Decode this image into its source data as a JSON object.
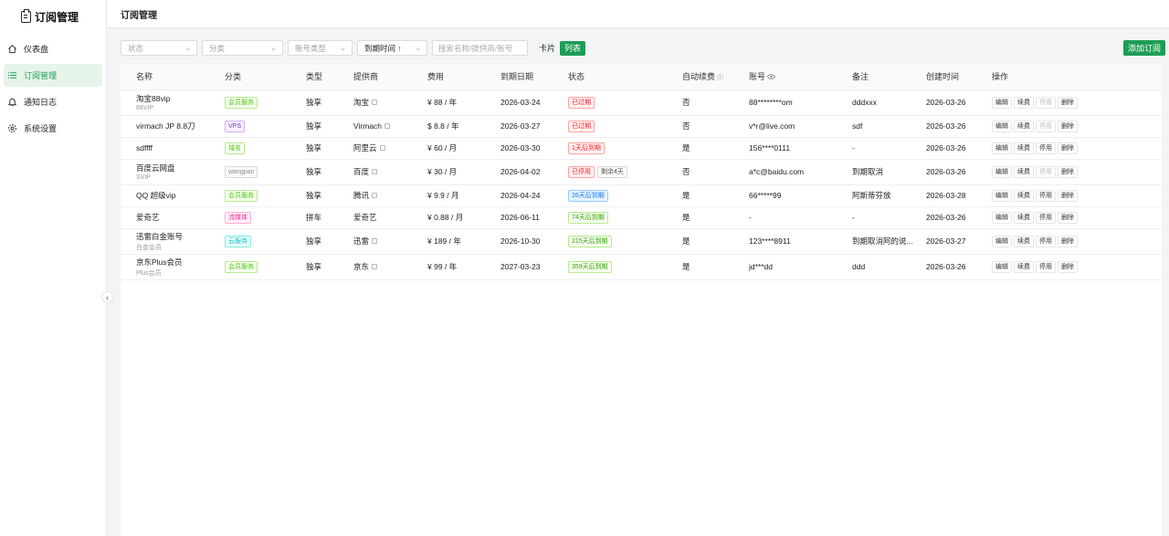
{
  "app": {
    "title": "订阅管理"
  },
  "nav": [
    {
      "label": "仪表盘",
      "icon": "home-icon",
      "active": false
    },
    {
      "label": "订阅管理",
      "icon": "list-icon",
      "active": true
    },
    {
      "label": "通知日志",
      "icon": "bell-icon",
      "active": false
    },
    {
      "label": "系统设置",
      "icon": "gear-icon",
      "active": false
    }
  ],
  "page": {
    "title": "订阅管理"
  },
  "filters": {
    "status_placeholder": "状态",
    "category_placeholder": "分类",
    "account_type_placeholder": "账号类型",
    "sort_value": "到期时间 ↑",
    "search_placeholder": "搜索名称/提供商/账号",
    "view_card": "卡片",
    "view_list": "列表"
  },
  "actions": {
    "add_label": "添加订阅"
  },
  "table": {
    "columns": [
      "名称",
      "分类",
      "类型",
      "提供商",
      "费用",
      "到期日期",
      "状态",
      "自动续费",
      "账号",
      "备注",
      "创建时间",
      "操作"
    ],
    "row_actions": [
      "编辑",
      "续费",
      "停用",
      "删除"
    ],
    "rows": [
      {
        "name": "淘宝88vip",
        "sub": "88VIP",
        "category": "会员服务",
        "category_style": "green",
        "type": "独享",
        "provider": "淘宝",
        "provider_link": true,
        "cost": "¥ 88 / 年",
        "expiry": "2026-03-24",
        "status": "已过期",
        "status_style": "red",
        "status2": "",
        "auto_renew": "否",
        "account": "88********om",
        "note": "dddxxx",
        "created": "2026-03-26",
        "disable_enabled": false
      },
      {
        "name": "virmach JP 8.8刀",
        "sub": "",
        "category": "VPS",
        "category_style": "purple",
        "type": "独享",
        "provider": "Virmach",
        "provider_link": true,
        "cost": "$ 8.8 / 年",
        "expiry": "2026-03-27",
        "status": "已过期",
        "status_style": "red",
        "status2": "",
        "auto_renew": "否",
        "account": "v*r@live.com",
        "note": "sdf",
        "created": "2026-03-26",
        "disable_enabled": false
      },
      {
        "name": "sdffff",
        "sub": "",
        "category": "域名",
        "category_style": "green",
        "type": "独享",
        "provider": "阿里云",
        "provider_link": true,
        "cost": "¥ 60 / 月",
        "expiry": "2026-03-30",
        "status": "1天后到期",
        "status_style": "red",
        "status2": "",
        "auto_renew": "是",
        "account": "156****0111",
        "note": "-",
        "created": "2026-03-26",
        "disable_enabled": true
      },
      {
        "name": "百度云网盘",
        "sub": "SVIP",
        "category": "wangpan",
        "category_style": "gray",
        "type": "独享",
        "provider": "百度",
        "provider_link": true,
        "cost": "¥ 30 / 月",
        "expiry": "2026-04-02",
        "status": "已停用",
        "status_style": "red",
        "status2": "剩余4天",
        "auto_renew": "否",
        "account": "a*c@baidu.com",
        "note": "到期取消",
        "created": "2026-03-26",
        "disable_enabled": false
      },
      {
        "name": "QQ 超级vip",
        "sub": "",
        "category": "会员服务",
        "category_style": "green",
        "type": "独享",
        "provider": "腾讯",
        "provider_link": true,
        "cost": "¥ 9.9 / 月",
        "expiry": "2026-04-24",
        "status": "26天后到期",
        "status_style": "blue",
        "status2": "",
        "auto_renew": "是",
        "account": "66*****99",
        "note": "阿斯蒂芬放",
        "created": "2026-03-28",
        "disable_enabled": true
      },
      {
        "name": "爱奇艺",
        "sub": "",
        "category": "流媒体",
        "category_style": "pink",
        "type": "拼车",
        "provider": "爱奇艺",
        "provider_link": false,
        "cost": "¥ 0.88 / 月",
        "expiry": "2026-06-11",
        "status": "74天后到期",
        "status_style": "green",
        "status2": "",
        "auto_renew": "是",
        "account": "-",
        "note": "-",
        "created": "2026-03-26",
        "disable_enabled": true
      },
      {
        "name": "迅雷白金账号",
        "sub": "白金会员",
        "category": "云服务",
        "category_style": "cyan",
        "type": "独享",
        "provider": "迅雷",
        "provider_link": true,
        "cost": "¥ 189 / 年",
        "expiry": "2026-10-30",
        "status": "215天后到期",
        "status_style": "green",
        "status2": "",
        "auto_renew": "是",
        "account": "123****8911",
        "note": "到期取消阿的说...",
        "created": "2026-03-27",
        "disable_enabled": true
      },
      {
        "name": "京东Plus会员",
        "sub": "Plus会员",
        "category": "会员服务",
        "category_style": "green",
        "type": "独享",
        "provider": "京东",
        "provider_link": true,
        "cost": "¥ 99 / 年",
        "expiry": "2027-03-23",
        "status": "359天后到期",
        "status_style": "green",
        "status2": "",
        "auto_renew": "是",
        "account": "jd***dd",
        "note": "ddd",
        "created": "2026-03-26",
        "disable_enabled": true
      }
    ]
  },
  "colors": {
    "accent": "#1f9d55",
    "tag_green": {
      "fg": "#52c41a",
      "bg": "#f6ffed",
      "border": "#b7eb8f"
    },
    "tag_purple": {
      "fg": "#722ed1",
      "bg": "#f9f0ff",
      "border": "#d3adf7"
    },
    "tag_gray": {
      "fg": "#8c8c8c",
      "bg": "#fafafa",
      "border": "#d9d9d9"
    },
    "tag_pink": {
      "fg": "#eb2f96",
      "bg": "#fff0f6",
      "border": "#ffadd2"
    },
    "tag_cyan": {
      "fg": "#13c2c2",
      "bg": "#e6fffb",
      "border": "#87e8de"
    },
    "tag_red": {
      "fg": "#f5222d",
      "bg": "#fff1f0",
      "border": "#ffa39e"
    },
    "tag_blue": {
      "fg": "#1677ff",
      "bg": "#e6f4ff",
      "border": "#91caff"
    },
    "tag_status_green": {
      "fg": "#389e0d",
      "bg": "#f6ffed",
      "border": "#b7eb8f"
    }
  }
}
